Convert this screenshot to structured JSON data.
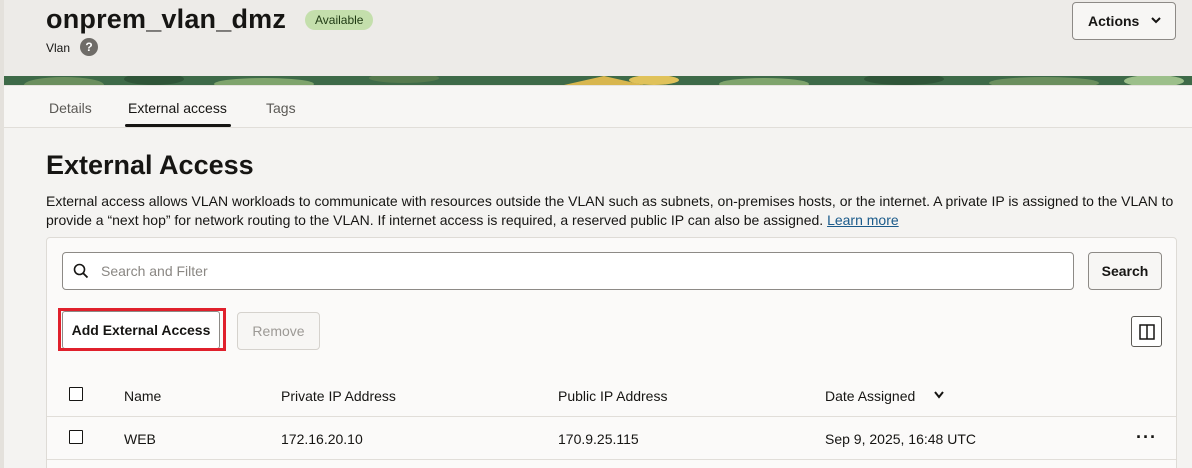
{
  "header": {
    "title": "onprem_vlan_dmz",
    "status_badge": "Available",
    "subtitle": "Vlan",
    "help_icon": "question-circle-icon",
    "actions_label": "Actions"
  },
  "tabs": [
    {
      "label": "Details",
      "active": false
    },
    {
      "label": "External access",
      "active": true
    },
    {
      "label": "Tags",
      "active": false
    }
  ],
  "section": {
    "title": "External Access",
    "description": "External access allows VLAN workloads to communicate with resources outside the VLAN such as subnets, on-premises hosts, or the internet. A private IP is assigned to the VLAN to provide a “next hop” for network routing to the VLAN. If internet access is required, a reserved public IP can also be assigned.",
    "learn_more": "Learn more"
  },
  "toolbar": {
    "search_placeholder": "Search and Filter",
    "search_label": "Search",
    "add_label": "Add External Access",
    "remove_label": "Remove"
  },
  "table": {
    "columns": [
      "Name",
      "Private IP Address",
      "Public IP Address",
      "Date Assigned"
    ],
    "sorted_column": "Date Assigned",
    "rows": [
      {
        "name": "WEB",
        "private_ip": "172.16.20.10",
        "public_ip": "170.9.25.115",
        "date": "Sep 9, 2025, 16:48 UTC"
      }
    ]
  },
  "colors": {
    "badge_bg": "#c4dfac",
    "highlight": "#e0202c",
    "link": "#1a5a8a"
  }
}
